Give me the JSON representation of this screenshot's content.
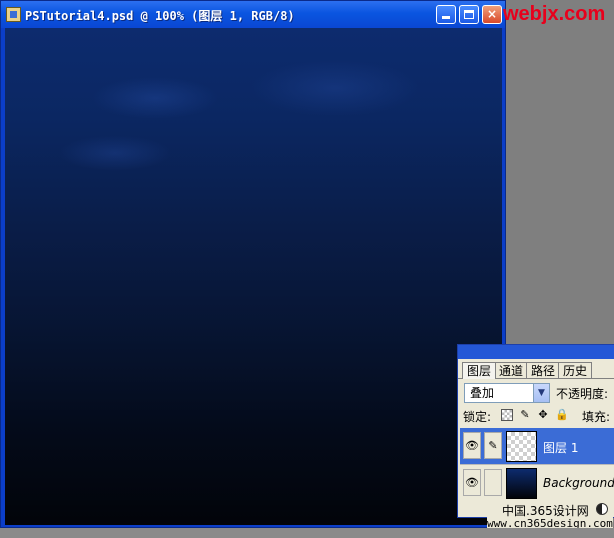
{
  "document": {
    "title": "PSTutorial4.psd @ 100% (图层 1, RGB/8)",
    "controls": {
      "minimize": "minimize",
      "maximize": "maximize",
      "close": "×"
    }
  },
  "watermark": {
    "top": "webjx.com",
    "cn": "中国.365设计网",
    "url": "www.cn365design.com"
  },
  "layers_panel": {
    "tabs": [
      "图层",
      "通道",
      "路径",
      "历史"
    ],
    "active_tab": "图层",
    "blend_mode": "叠加",
    "opacity_label": "不透明度:",
    "lock_label": "锁定:",
    "fill_label": "填充:",
    "layers": [
      {
        "name": "图层 1",
        "selected": true,
        "visible": true,
        "thumbnail": "transparent"
      },
      {
        "name": "Background",
        "selected": false,
        "visible": true,
        "thumbnail": "dark-blue-gradient"
      }
    ]
  },
  "icons": {
    "eye": "👁",
    "brush": "✎",
    "move": "✥",
    "padlock": "🔒",
    "dropdown": "▼"
  }
}
